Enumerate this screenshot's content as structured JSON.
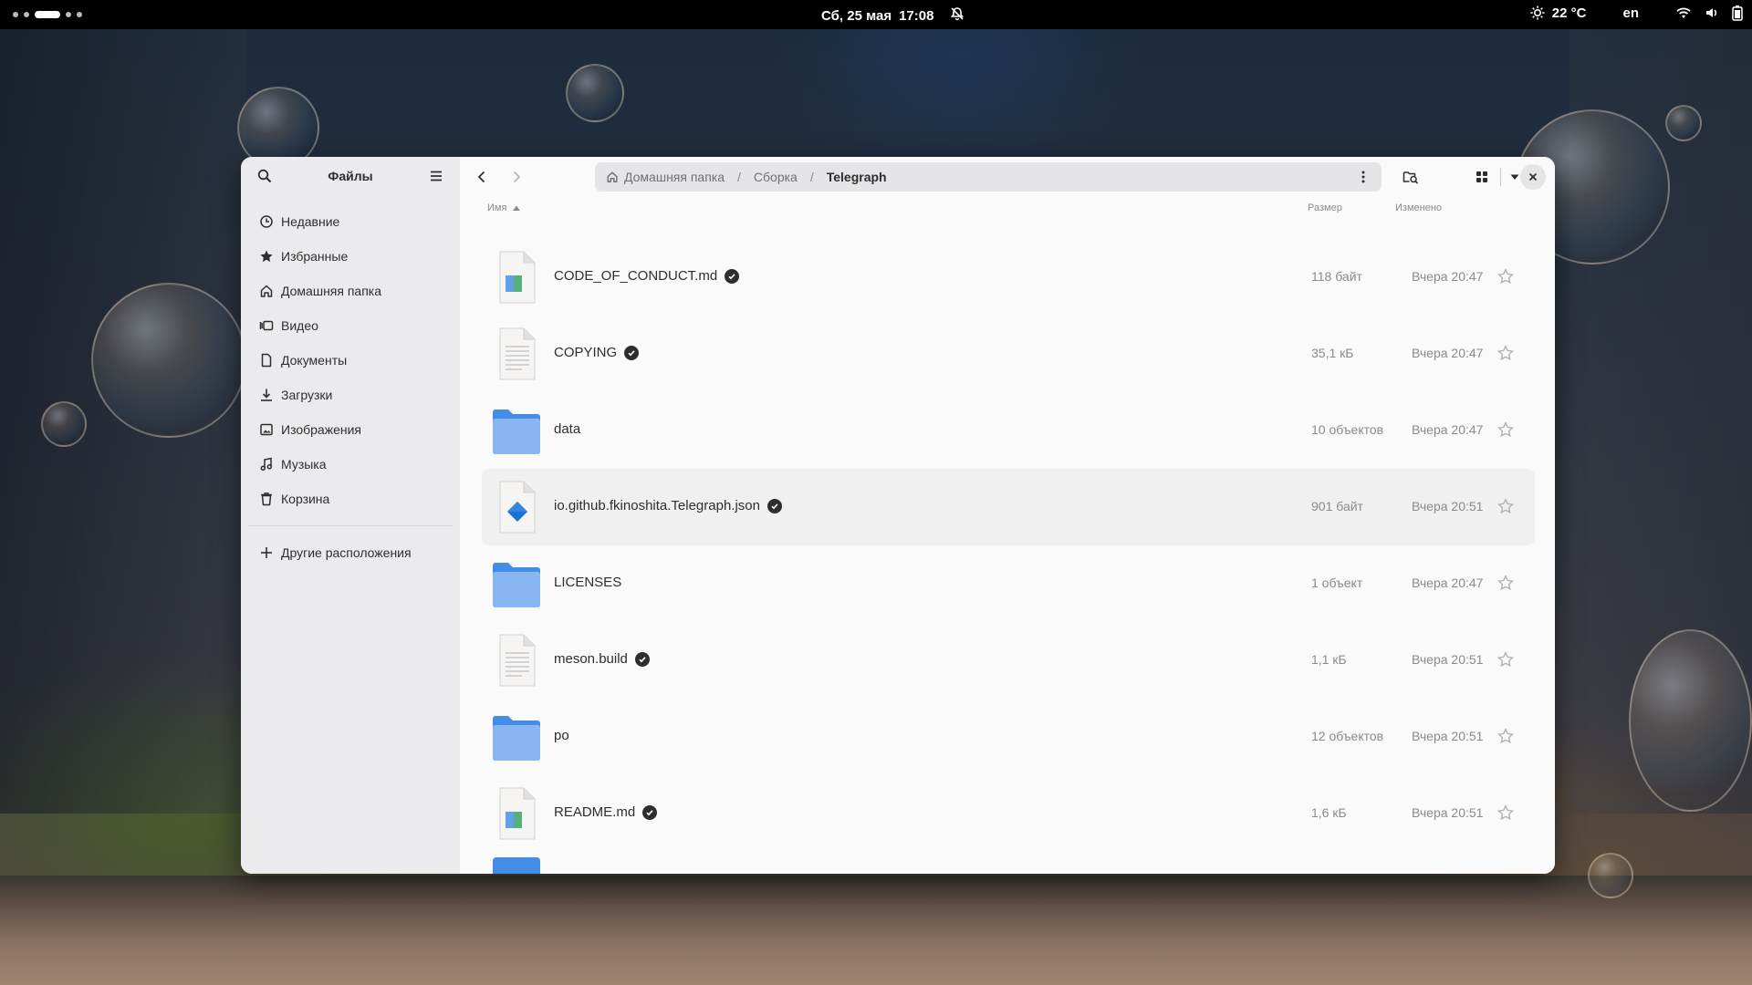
{
  "topbar": {
    "date": "Сб, 25 мая",
    "time": "17:08",
    "weather": "22 °C",
    "keyboard_layout": "en"
  },
  "sidebar": {
    "title": "Файлы",
    "places": [
      {
        "label": "Недавние",
        "icon": "clock-icon"
      },
      {
        "label": "Избранные",
        "icon": "star-icon"
      },
      {
        "label": "Домашняя папка",
        "icon": "home-icon"
      },
      {
        "label": "Видео",
        "icon": "video-icon"
      },
      {
        "label": "Документы",
        "icon": "document-icon"
      },
      {
        "label": "Загрузки",
        "icon": "download-icon"
      },
      {
        "label": "Изображения",
        "icon": "image-icon"
      },
      {
        "label": "Музыка",
        "icon": "music-icon"
      },
      {
        "label": "Корзина",
        "icon": "trash-icon"
      }
    ],
    "other_locations": "Другие расположения"
  },
  "pathbar": {
    "crumbs": [
      "Домашняя папка",
      "Сборка"
    ],
    "current": "Telegraph"
  },
  "columns": {
    "name": "Имя",
    "size": "Размер",
    "modified": "Изменено"
  },
  "files": [
    {
      "name": "CODE_OF_CONDUCT.md",
      "type": "text-markdown",
      "size": "118 байт",
      "modified": "Вчера 20:47",
      "synced": true
    },
    {
      "name": "COPYING",
      "type": "text-plain",
      "size": "35,1 кБ",
      "modified": "Вчера 20:47",
      "synced": true
    },
    {
      "name": "data",
      "type": "folder",
      "size": "10 объектов",
      "modified": "Вчера 20:47",
      "synced": false
    },
    {
      "name": "io.github.fkinoshita.Telegraph.json",
      "type": "json",
      "size": "901 байт",
      "modified": "Вчера 20:51",
      "synced": true
    },
    {
      "name": "LICENSES",
      "type": "folder",
      "size": "1 объект",
      "modified": "Вчера 20:47",
      "synced": false
    },
    {
      "name": "meson.build",
      "type": "text-plain",
      "size": "1,1 кБ",
      "modified": "Вчера 20:51",
      "synced": true
    },
    {
      "name": "po",
      "type": "folder",
      "size": "12 объектов",
      "modified": "Вчера 20:51",
      "synced": false
    },
    {
      "name": "README.md",
      "type": "text-markdown",
      "size": "1,6 кБ",
      "modified": "Вчера 20:51",
      "synced": true
    }
  ],
  "colors": {
    "folder": "#438de6",
    "folder_light": "#87b6f0",
    "accent_json": "#1c71d8"
  }
}
